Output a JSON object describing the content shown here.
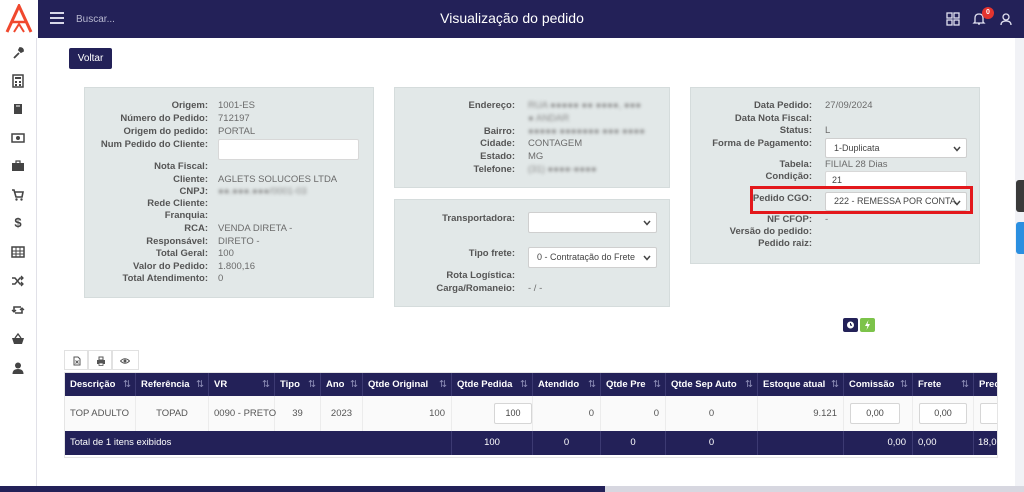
{
  "header": {
    "title": "Visualização do pedido",
    "search_placeholder": "Buscar...",
    "notification_count": "0"
  },
  "colors": {
    "primary": "#232158",
    "danger": "#e3342f",
    "highlight": "#e3181c",
    "panel": "#e2e8e8"
  },
  "sidebar": {
    "icons": [
      "wrench-icon",
      "calculator-icon",
      "book-icon",
      "money-icon",
      "briefcase-icon",
      "cart-icon",
      "dollar-icon",
      "table-icon",
      "shuffle-icon",
      "retweet-icon",
      "basket-icon",
      "user-icon"
    ],
    "dollar_glyph": "$"
  },
  "actions": {
    "back_label": "Voltar"
  },
  "left_panel": {
    "origem_label": "Origem:",
    "origem": "1001-ES",
    "numero_label": "Número do Pedido:",
    "numero": "712197",
    "origem_pedido_label": "Origem do pedido:",
    "origem_pedido": "PORTAL",
    "num_cliente_label": "Num Pedido do Cliente:",
    "num_cliente": "",
    "nota_fiscal_label": "Nota Fiscal:",
    "nota_fiscal": "",
    "cliente_label": "Cliente:",
    "cliente": "AGLETS SOLUCOES LTDA",
    "cnpj_label": "CNPJ:",
    "cnpj": "●●.●●●.●●●/0001-03",
    "rede_label": "Rede Cliente:",
    "rede": "",
    "franquia_label": "Franquia:",
    "franquia": "",
    "rca_label": "RCA:",
    "rca": "VENDA DIRETA -",
    "responsavel_label": "Responsável:",
    "responsavel": "DIRETO -",
    "total_geral_label": "Total Geral:",
    "total_geral": "100",
    "valor_label": "Valor do Pedido:",
    "valor": "1.800,16",
    "total_atend_label": "Total Atendimento:",
    "total_atend": "0"
  },
  "address_panel": {
    "endereco_label": "Endereço:",
    "endereco": "RUA ●●●●● ●● ●●●●, ●●●",
    "endereco2": "● ANDAR",
    "bairro_label": "Bairro:",
    "bairro": "●●●●● ●●●●●●● ●●● ●●●●",
    "cidade_label": "Cidade:",
    "cidade": "CONTAGEM",
    "estado_label": "Estado:",
    "estado": "MG",
    "telefone_label": "Telefone:",
    "telefone": "(31) ●●●●-●●●●"
  },
  "transport_panel": {
    "transportadora_label": "Transportadora:",
    "transportadora": "",
    "tipo_frete_label": "Tipo frete:",
    "tipo_frete": "0 - Contratação do Frete",
    "rota_label": "Rota Logística:",
    "rota": "",
    "carga_label": "Carga/Romaneio:",
    "carga": "- / -"
  },
  "right_panel": {
    "data_pedido_label": "Data Pedido:",
    "data_pedido": "27/09/2024",
    "data_nf_label": "Data Nota Fiscal:",
    "data_nf": "",
    "status_label": "Status:",
    "status": "L",
    "forma_pag_label": "Forma de Pagamento:",
    "forma_pag": "1-Duplicata",
    "tabela_label": "Tabela:",
    "tabela": "FILIAL 28 Dias",
    "condicao_label": "Condição:",
    "condicao": "21",
    "pedido_cgo_label": "Pedido CGO:",
    "pedido_cgo": "222 - REMESSA POR CONTA",
    "nf_cfop_label": "NF CFOP:",
    "nf_cfop": "-",
    "versao_label": "Versão do pedido:",
    "versao": "",
    "pedido_raiz_label": "Pedido raiz:",
    "pedido_raiz": ""
  },
  "table": {
    "columns": [
      "Descrição",
      "Referência",
      "VR",
      "Tipo",
      "Ano",
      "Qtde Original",
      "Qtde Pedida",
      "Atendido",
      "Qtde Pre",
      "Qtde Sep Auto",
      "Estoque atual",
      "Comissão",
      "Frete",
      "Prec"
    ],
    "sort_glyph": "⇅",
    "rows": [
      {
        "descricao": "TOP ADULTO",
        "referencia": "TOPAD",
        "vr": "0090 - PRETO",
        "tipo": "39",
        "ano": "2023",
        "qtde_original": "100",
        "qtde_pedida": "100",
        "atendido": "0",
        "qtde_pre": "0",
        "qtde_sep_auto": "0",
        "estoque": "9.121",
        "comissao": "0,00",
        "frete": "0,00"
      }
    ],
    "footer": {
      "label": "Total de 1 itens exibidos",
      "qtde_pedida": "100",
      "atendido": "0",
      "qtde_pre": "0",
      "qtde_sep_auto": "0",
      "comissao": "0,00",
      "frete": "0,00",
      "preco": "18,0"
    }
  }
}
